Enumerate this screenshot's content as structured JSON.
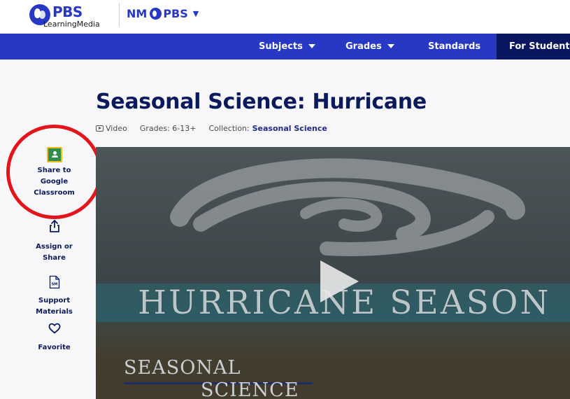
{
  "logo": {
    "word": "PBS",
    "sub": "LearningMedia"
  },
  "station": {
    "prefix": "NM",
    "suffix": "PBS"
  },
  "nav": {
    "subjects": "Subjects",
    "grades": "Grades",
    "standards": "Standards",
    "students": "For Students"
  },
  "page": {
    "title": "Seasonal Science: Hurricane",
    "type": "Video",
    "grades": "Grades: 6-13+",
    "collection_label": "Collection:",
    "collection_value": "Seasonal Science"
  },
  "actions": {
    "classroom": [
      "Share to",
      "Google",
      "Classroom"
    ],
    "assign": [
      "Assign or",
      "Share"
    ],
    "support": [
      "Support",
      "Materials"
    ],
    "favorite": "Favorite",
    "sm_icon_text": "SM"
  },
  "video": {
    "title": "HURRICANE SEASON",
    "sub1": "SEASONAL",
    "sub2": "SCIENCE"
  },
  "colors": {
    "brand": "#2638c4",
    "nav_active": "#0a1660",
    "title": "#0a1a5c",
    "highlight": "#e3151b"
  },
  "icons": [
    "pbs-logo-icon",
    "caret-down-icon",
    "video-play-icon",
    "google-classroom-icon",
    "share-icon",
    "support-materials-icon",
    "heart-icon",
    "video-play-button-icon"
  ]
}
